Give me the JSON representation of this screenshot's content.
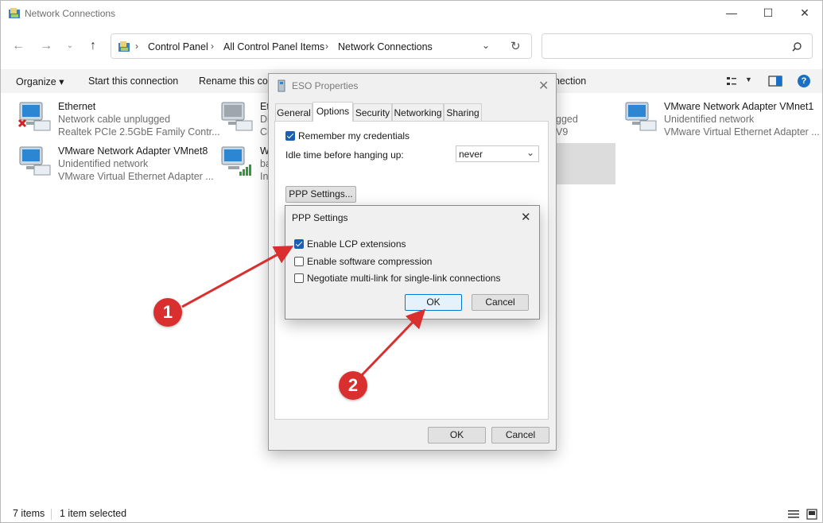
{
  "window": {
    "title": "Network Connections",
    "controls": {
      "minimize": "—",
      "maximize": "☐",
      "close": "✕"
    }
  },
  "nav": {
    "breadcrumbs": [
      "Control Panel",
      "All Control Panel Items",
      "Network Connections"
    ]
  },
  "search": {
    "placeholder": ""
  },
  "toolbar": {
    "organize": "Organize ▾",
    "start_connection": "Start this connection",
    "rename": "Rename this con",
    "right_fragment": "nnection"
  },
  "items": [
    {
      "name": "Ethernet",
      "line2": "Network cable unplugged",
      "line3": "Realtek PCIe 2.5GbE Family Contr..."
    },
    {
      "name": "Et",
      "line2": "Di",
      "line3": "Ci"
    },
    {
      "name": "",
      "line2": "gged",
      "line3": "V9"
    },
    {
      "name": "VMware Network Adapter VMnet1",
      "line2": "Unidentified network",
      "line3": "VMware Virtual Ethernet Adapter ..."
    },
    {
      "name": "VMware Network Adapter VMnet8",
      "line2": "Unidentified network",
      "line3": "VMware Virtual Ethernet Adapter ..."
    },
    {
      "name": "W",
      "line2": "ba",
      "line3": "In"
    }
  ],
  "status": {
    "count": "7 items",
    "selected": "1 item selected"
  },
  "eso_dialog": {
    "title": "ESO Properties",
    "tabs": [
      "General",
      "Options",
      "Security",
      "Networking",
      "Sharing"
    ],
    "active_tab": "Options",
    "remember_label": "Remember my credentials",
    "remember_checked": true,
    "idle_label": "Idle time before hanging up:",
    "idle_value": "never",
    "ppp_button": "PPP Settings...",
    "ok": "OK",
    "cancel": "Cancel"
  },
  "ppp_dialog": {
    "title": "PPP Settings",
    "options": [
      {
        "label": "Enable LCP extensions",
        "checked": true
      },
      {
        "label": "Enable software compression",
        "checked": false
      },
      {
        "label": "Negotiate multi-link for single-link connections",
        "checked": false
      }
    ],
    "ok": "OK",
    "cancel": "Cancel"
  },
  "annotations": {
    "badge1": "1",
    "badge2": "2",
    "color": "#d92f2f"
  }
}
